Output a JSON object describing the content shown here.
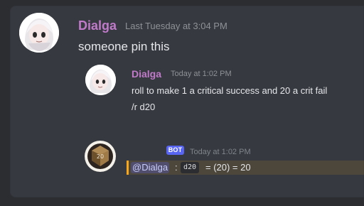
{
  "messages": {
    "main": {
      "author": "Dialga",
      "timestamp": "Last Tuesday at 3:04 PM",
      "text": "someone pin this"
    },
    "quoted": {
      "author": "Dialga",
      "timestamp": "Today at 1:02 PM",
      "line1": "roll to make 1 a critical success and 20 a crit fail",
      "line2": "/r d20"
    },
    "bot": {
      "badge": "BOT",
      "timestamp": "Today at 1:02 PM",
      "mention": "@Dialga",
      "colon": ":",
      "code": "d20",
      "result": "= (20) = 20"
    }
  },
  "icons": {
    "main_avatar": "anime-avatar",
    "quote_avatar": "anime-avatar",
    "bot_avatar": "dice-avatar"
  },
  "colors": {
    "background": "#2b2d31",
    "card": "#36393f",
    "author": "#c07ac9",
    "bot_badge": "#5865f2",
    "mention_bar": "#faa61a"
  }
}
